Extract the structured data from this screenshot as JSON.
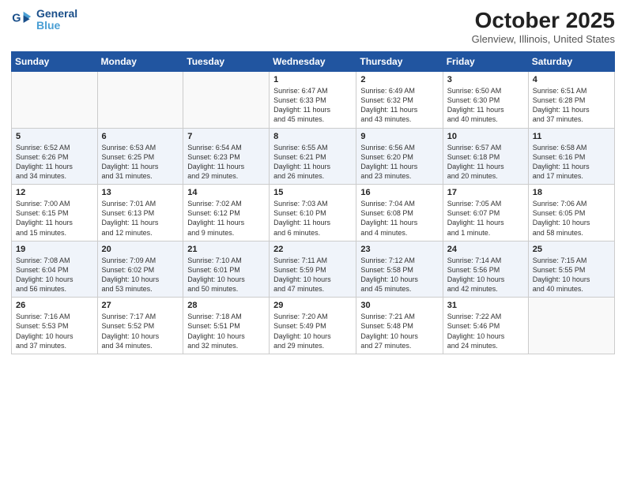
{
  "header": {
    "logo_line1": "General",
    "logo_line2": "Blue",
    "month": "October 2025",
    "location": "Glenview, Illinois, United States"
  },
  "weekdays": [
    "Sunday",
    "Monday",
    "Tuesday",
    "Wednesday",
    "Thursday",
    "Friday",
    "Saturday"
  ],
  "weeks": [
    [
      {
        "day": "",
        "info": ""
      },
      {
        "day": "",
        "info": ""
      },
      {
        "day": "",
        "info": ""
      },
      {
        "day": "1",
        "info": "Sunrise: 6:47 AM\nSunset: 6:33 PM\nDaylight: 11 hours\nand 45 minutes."
      },
      {
        "day": "2",
        "info": "Sunrise: 6:49 AM\nSunset: 6:32 PM\nDaylight: 11 hours\nand 43 minutes."
      },
      {
        "day": "3",
        "info": "Sunrise: 6:50 AM\nSunset: 6:30 PM\nDaylight: 11 hours\nand 40 minutes."
      },
      {
        "day": "4",
        "info": "Sunrise: 6:51 AM\nSunset: 6:28 PM\nDaylight: 11 hours\nand 37 minutes."
      }
    ],
    [
      {
        "day": "5",
        "info": "Sunrise: 6:52 AM\nSunset: 6:26 PM\nDaylight: 11 hours\nand 34 minutes."
      },
      {
        "day": "6",
        "info": "Sunrise: 6:53 AM\nSunset: 6:25 PM\nDaylight: 11 hours\nand 31 minutes."
      },
      {
        "day": "7",
        "info": "Sunrise: 6:54 AM\nSunset: 6:23 PM\nDaylight: 11 hours\nand 29 minutes."
      },
      {
        "day": "8",
        "info": "Sunrise: 6:55 AM\nSunset: 6:21 PM\nDaylight: 11 hours\nand 26 minutes."
      },
      {
        "day": "9",
        "info": "Sunrise: 6:56 AM\nSunset: 6:20 PM\nDaylight: 11 hours\nand 23 minutes."
      },
      {
        "day": "10",
        "info": "Sunrise: 6:57 AM\nSunset: 6:18 PM\nDaylight: 11 hours\nand 20 minutes."
      },
      {
        "day": "11",
        "info": "Sunrise: 6:58 AM\nSunset: 6:16 PM\nDaylight: 11 hours\nand 17 minutes."
      }
    ],
    [
      {
        "day": "12",
        "info": "Sunrise: 7:00 AM\nSunset: 6:15 PM\nDaylight: 11 hours\nand 15 minutes."
      },
      {
        "day": "13",
        "info": "Sunrise: 7:01 AM\nSunset: 6:13 PM\nDaylight: 11 hours\nand 12 minutes."
      },
      {
        "day": "14",
        "info": "Sunrise: 7:02 AM\nSunset: 6:12 PM\nDaylight: 11 hours\nand 9 minutes."
      },
      {
        "day": "15",
        "info": "Sunrise: 7:03 AM\nSunset: 6:10 PM\nDaylight: 11 hours\nand 6 minutes."
      },
      {
        "day": "16",
        "info": "Sunrise: 7:04 AM\nSunset: 6:08 PM\nDaylight: 11 hours\nand 4 minutes."
      },
      {
        "day": "17",
        "info": "Sunrise: 7:05 AM\nSunset: 6:07 PM\nDaylight: 11 hours\nand 1 minute."
      },
      {
        "day": "18",
        "info": "Sunrise: 7:06 AM\nSunset: 6:05 PM\nDaylight: 10 hours\nand 58 minutes."
      }
    ],
    [
      {
        "day": "19",
        "info": "Sunrise: 7:08 AM\nSunset: 6:04 PM\nDaylight: 10 hours\nand 56 minutes."
      },
      {
        "day": "20",
        "info": "Sunrise: 7:09 AM\nSunset: 6:02 PM\nDaylight: 10 hours\nand 53 minutes."
      },
      {
        "day": "21",
        "info": "Sunrise: 7:10 AM\nSunset: 6:01 PM\nDaylight: 10 hours\nand 50 minutes."
      },
      {
        "day": "22",
        "info": "Sunrise: 7:11 AM\nSunset: 5:59 PM\nDaylight: 10 hours\nand 47 minutes."
      },
      {
        "day": "23",
        "info": "Sunrise: 7:12 AM\nSunset: 5:58 PM\nDaylight: 10 hours\nand 45 minutes."
      },
      {
        "day": "24",
        "info": "Sunrise: 7:14 AM\nSunset: 5:56 PM\nDaylight: 10 hours\nand 42 minutes."
      },
      {
        "day": "25",
        "info": "Sunrise: 7:15 AM\nSunset: 5:55 PM\nDaylight: 10 hours\nand 40 minutes."
      }
    ],
    [
      {
        "day": "26",
        "info": "Sunrise: 7:16 AM\nSunset: 5:53 PM\nDaylight: 10 hours\nand 37 minutes."
      },
      {
        "day": "27",
        "info": "Sunrise: 7:17 AM\nSunset: 5:52 PM\nDaylight: 10 hours\nand 34 minutes."
      },
      {
        "day": "28",
        "info": "Sunrise: 7:18 AM\nSunset: 5:51 PM\nDaylight: 10 hours\nand 32 minutes."
      },
      {
        "day": "29",
        "info": "Sunrise: 7:20 AM\nSunset: 5:49 PM\nDaylight: 10 hours\nand 29 minutes."
      },
      {
        "day": "30",
        "info": "Sunrise: 7:21 AM\nSunset: 5:48 PM\nDaylight: 10 hours\nand 27 minutes."
      },
      {
        "day": "31",
        "info": "Sunrise: 7:22 AM\nSunset: 5:46 PM\nDaylight: 10 hours\nand 24 minutes."
      },
      {
        "day": "",
        "info": ""
      }
    ]
  ]
}
